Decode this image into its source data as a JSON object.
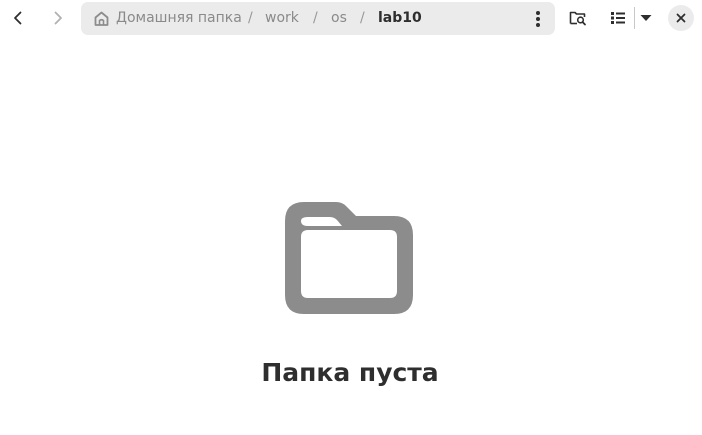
{
  "pathbar": {
    "crumbs": [
      {
        "label": "Домашняя папка",
        "icon": "home-icon"
      },
      {
        "label": "work"
      },
      {
        "label": "os"
      },
      {
        "label": "lab10"
      }
    ],
    "separator": "/"
  },
  "main": {
    "empty_icon": "folder-icon",
    "empty_title": "Папка пуста"
  },
  "colors": {
    "pathbar_bg": "#ebebeb",
    "icon_gray": "#8c8c8c",
    "text_dark": "#2e2e2e",
    "text_muted": "#8a8a8a"
  }
}
